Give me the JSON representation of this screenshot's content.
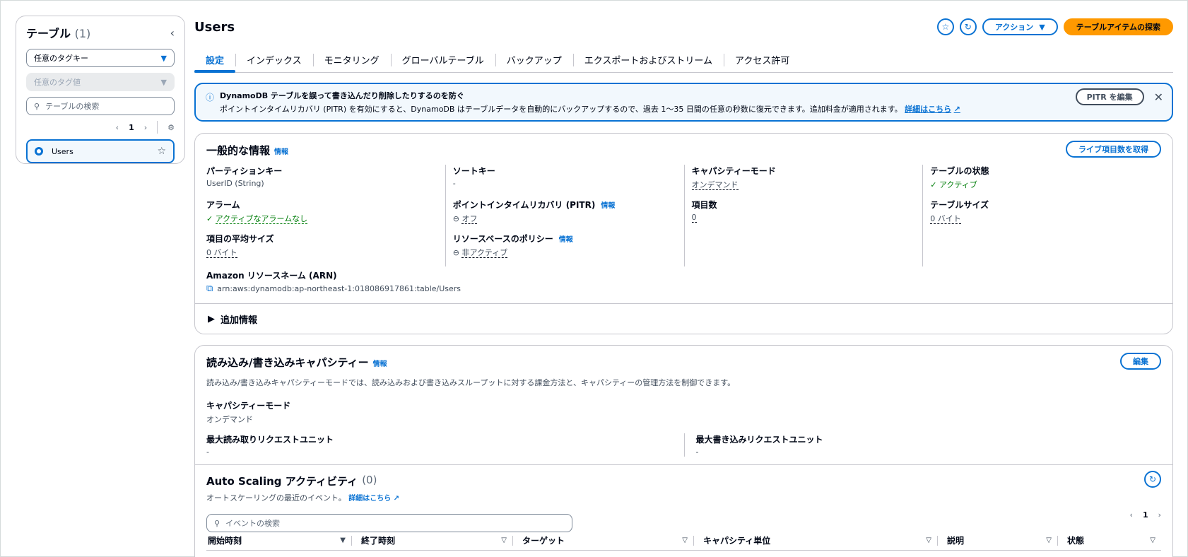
{
  "sidebar": {
    "title": "テーブル",
    "count": "(1)",
    "tag_key_placeholder": "任意のタグキー",
    "tag_value_placeholder": "任意のタグ値",
    "search_placeholder": "テーブルの検索",
    "page": "1",
    "items": [
      {
        "label": "Users"
      }
    ]
  },
  "header": {
    "title": "Users",
    "actions_label": "アクション",
    "explore_label": "テーブルアイテムの探索"
  },
  "tabs": [
    "設定",
    "インデックス",
    "モニタリング",
    "グローバルテーブル",
    "バックアップ",
    "エクスポートおよびストリーム",
    "アクセス許可"
  ],
  "alert": {
    "title": "DynamoDB テーブルを誤って書き込んだり削除したりするのを防ぐ",
    "body": "ポイントインタイムリカバリ (PITR) を有効にすると、DynamoDB はテーブルデータを自動的にバックアップするので、過去 1〜35 日間の任意の秒数に復元できます。追加料金が適用されます。",
    "link": "詳細はこちら",
    "button": "PITR を編集"
  },
  "general": {
    "title": "一般的な情報",
    "info": "情報",
    "live_count_button": "ライブ項目数を取得",
    "partition_key_label": "パーティションキー",
    "partition_key_value": "UserID (String)",
    "alarm_label": "アラーム",
    "alarm_value": "アクティブなアラームなし",
    "avg_size_label": "項目の平均サイズ",
    "avg_size_value": "0 バイト",
    "sort_key_label": "ソートキー",
    "sort_key_value": "-",
    "pitr_label": "ポイントインタイムリカバリ (PITR)",
    "pitr_value": "オフ",
    "resource_policy_label": "リソースベースのポリシー",
    "resource_policy_value": "非アクティブ",
    "capacity_mode_label": "キャパシティーモード",
    "capacity_mode_value": "オンデマンド",
    "item_count_label": "項目数",
    "item_count_value": "0",
    "table_status_label": "テーブルの状態",
    "table_status_value": "アクティブ",
    "table_size_label": "テーブルサイズ",
    "table_size_value": "0 バイト",
    "arn_label": "Amazon リソースネーム (ARN)",
    "arn_value": "arn:aws:dynamodb:ap-northeast-1:018086917861:table/Users",
    "more_info": "追加情報"
  },
  "capacity": {
    "title": "読み込み/書き込みキャパシティー",
    "info": "情報",
    "edit_button": "編集",
    "description": "読み込み/書き込みキャパシティーモードでは、読み込みおよび書き込みスループットに対する課金方法と、キャパシティーの管理方法を制御できます。",
    "mode_label": "キャパシティーモード",
    "mode_value": "オンデマンド",
    "max_read_label": "最大読み取りリクエストユニット",
    "max_read_value": "-",
    "max_write_label": "最大書き込みリクエストユニット",
    "max_write_value": "-"
  },
  "autoscaling": {
    "title": "Auto Scaling アクティビティ",
    "count": "(0)",
    "subtitle": "オートスケーリングの最近のイベント。",
    "link": "詳細はこちら",
    "search_placeholder": "イベントの検索",
    "page": "1",
    "columns": [
      "開始時刻",
      "終了時刻",
      "ターゲット",
      "キャパシティ単位",
      "説明",
      "状態"
    ]
  },
  "colors": {
    "accent": "#0972d3",
    "primary": "#ff9900",
    "success": "#037f0c"
  }
}
